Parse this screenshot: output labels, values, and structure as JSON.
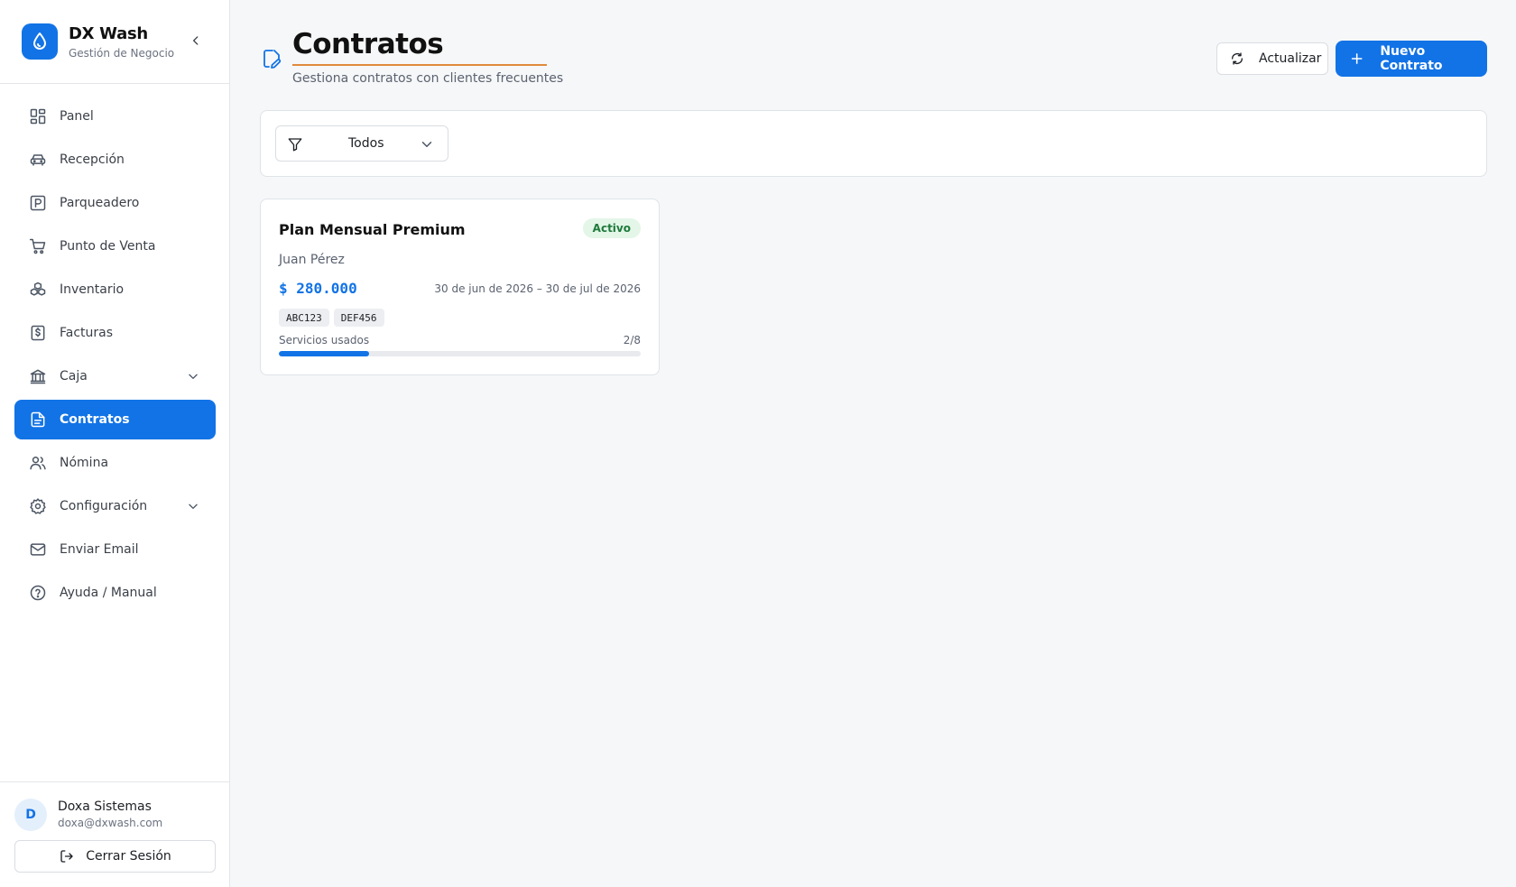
{
  "brand": {
    "name": "DX Wash",
    "subtitle": "Gestión de Negocio",
    "accent": "#1273e6"
  },
  "sidebar": {
    "items": [
      {
        "label": "Panel",
        "icon": "dashboard-icon"
      },
      {
        "label": "Recepción",
        "icon": "car-icon"
      },
      {
        "label": "Parqueadero",
        "icon": "parking-icon"
      },
      {
        "label": "Punto de Venta",
        "icon": "cart-icon"
      },
      {
        "label": "Inventario",
        "icon": "boxes-icon"
      },
      {
        "label": "Facturas",
        "icon": "receipt-icon"
      },
      {
        "label": "Caja",
        "icon": "bank-icon",
        "expandable": true
      },
      {
        "label": "Contratos",
        "icon": "document-icon",
        "active": true
      },
      {
        "label": "Nómina",
        "icon": "users-icon"
      },
      {
        "label": "Configuración",
        "icon": "gear-icon",
        "expandable": true
      },
      {
        "label": "Enviar Email",
        "icon": "mail-icon"
      },
      {
        "label": "Ayuda / Manual",
        "icon": "help-icon"
      }
    ]
  },
  "user": {
    "initial": "D",
    "name": "Doxa Sistemas",
    "email": "doxa@dxwash.com",
    "logout_label": "Cerrar Sesión"
  },
  "header": {
    "title": "Contratos",
    "subtitle": "Gestiona contratos con clientes frecuentes",
    "refresh_label": "Actualizar",
    "new_label": "Nuevo Contrato"
  },
  "filter": {
    "selected": "Todos"
  },
  "contracts": [
    {
      "title": "Plan Mensual Premium",
      "status": "Activo",
      "client": "Juan Pérez",
      "amount": "$ 280.000",
      "dates": "30 de jun de 2026 – 30 de jul de 2026",
      "plates": [
        "ABC123",
        "DEF456"
      ],
      "usage_label": "Servicios usados",
      "usage_text": "2/8",
      "usage_used": 2,
      "usage_total": 8
    }
  ]
}
